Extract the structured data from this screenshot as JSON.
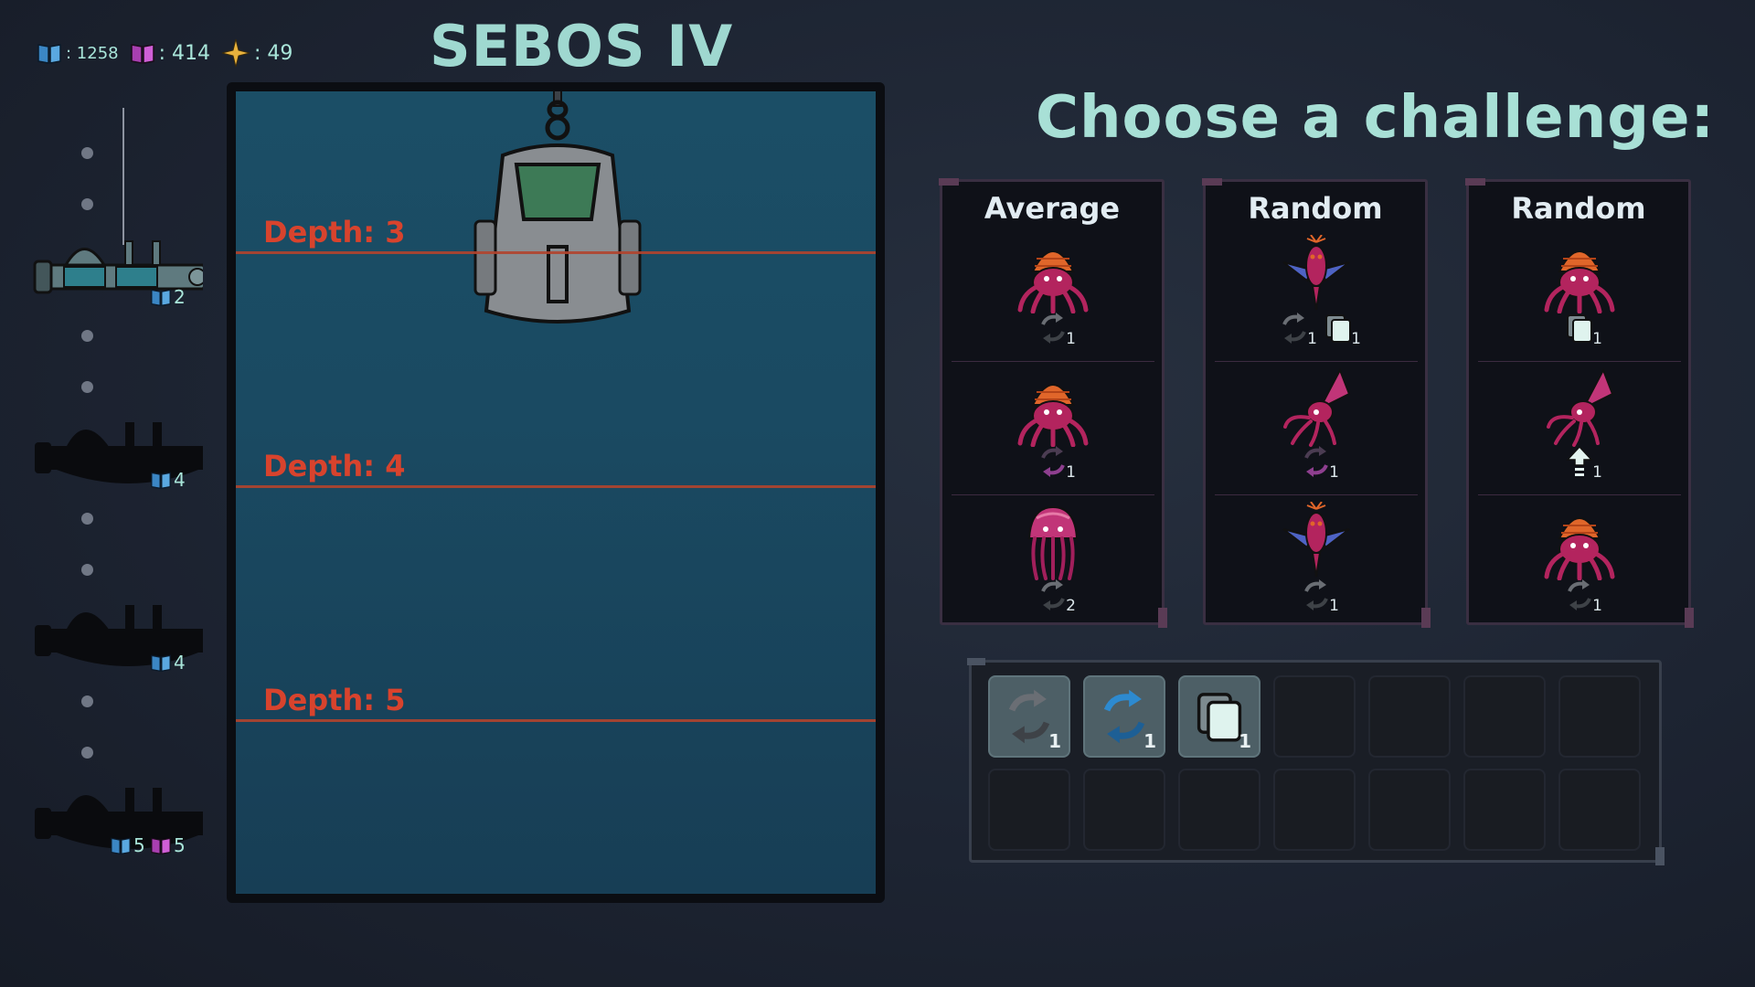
{
  "resources": {
    "blue_books": ": 1258",
    "purple_books": ": 414",
    "stars": ": 49"
  },
  "location_title": "SEBOS IV",
  "depth_track": {
    "submarines": [
      {
        "state": "current",
        "badges": [
          {
            "icon": "blue-book-icon",
            "count": "2"
          }
        ]
      },
      {
        "state": "locked",
        "badges": [
          {
            "icon": "blue-book-icon",
            "count": "4"
          }
        ]
      },
      {
        "state": "locked",
        "badges": [
          {
            "icon": "blue-book-icon",
            "count": "4"
          }
        ]
      },
      {
        "state": "locked",
        "badges": [
          {
            "icon": "blue-book-icon",
            "count": "5"
          },
          {
            "icon": "purple-book-icon",
            "count": "5"
          }
        ]
      }
    ]
  },
  "depth_view": {
    "labels": [
      "Depth: 3",
      "Depth: 4",
      "Depth: 5"
    ]
  },
  "challenge": {
    "heading": "Choose a challenge:",
    "cards": [
      {
        "title": "Average",
        "slots": [
          {
            "creature": "hermit-crab",
            "mods": [
              {
                "icon": "reroll-icon",
                "count": "1"
              }
            ]
          },
          {
            "creature": "hermit-crab",
            "mods": [
              {
                "icon": "reroll-purple-icon",
                "count": "1"
              }
            ]
          },
          {
            "creature": "jellyfish",
            "mods": [
              {
                "icon": "reroll-icon",
                "count": "2"
              }
            ]
          }
        ]
      },
      {
        "title": "Random",
        "slots": [
          {
            "creature": "winged-shrimp",
            "mods": [
              {
                "icon": "reroll-icon",
                "count": "1"
              },
              {
                "icon": "card-icon",
                "count": "1"
              }
            ]
          },
          {
            "creature": "squid",
            "mods": [
              {
                "icon": "reroll-purple-icon",
                "count": "1"
              }
            ]
          },
          {
            "creature": "winged-shrimp",
            "mods": [
              {
                "icon": "reroll-icon",
                "count": "1"
              }
            ]
          }
        ]
      },
      {
        "title": "Random",
        "slots": [
          {
            "creature": "hermit-crab",
            "mods": [
              {
                "icon": "card-icon",
                "count": "1"
              }
            ]
          },
          {
            "creature": "squid",
            "mods": [
              {
                "icon": "upgrade-arrow-icon",
                "count": "1"
              }
            ]
          },
          {
            "creature": "hermit-crab",
            "mods": [
              {
                "icon": "reroll-icon",
                "count": "1"
              }
            ]
          }
        ]
      }
    ]
  },
  "inventory": {
    "slots": [
      {
        "icon": "reroll-icon",
        "count": "1"
      },
      {
        "icon": "reroll-blue-icon",
        "count": "1"
      },
      {
        "icon": "card-icon",
        "count": "1"
      },
      {},
      {},
      {},
      {},
      {},
      {},
      {},
      {},
      {},
      {},
      {}
    ]
  },
  "colors": {
    "accent_teal": "#a8e0d6",
    "depth_red": "#d8432d",
    "creature_magenta": "#b3245e",
    "creature_orange": "#e0662a"
  }
}
